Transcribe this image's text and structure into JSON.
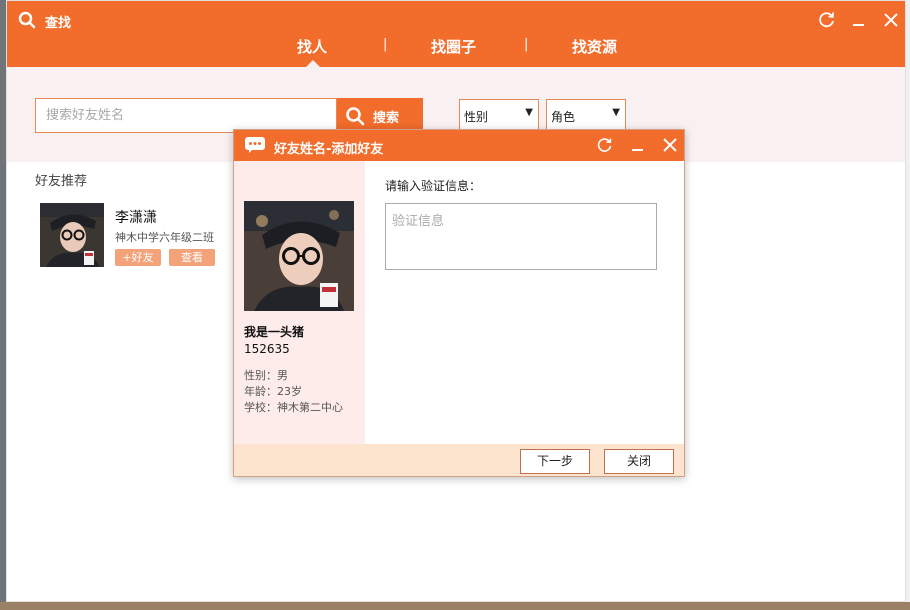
{
  "app": {
    "title": "查找"
  },
  "tabs": [
    {
      "label": "找人",
      "active": true
    },
    {
      "label": "找圈子",
      "active": false
    },
    {
      "label": "找资源",
      "active": false
    }
  ],
  "tab_separator": "|",
  "search": {
    "placeholder": "搜索好友姓名",
    "button_label": "搜索",
    "gender_select": "性别",
    "role_select": "角色"
  },
  "recommend": {
    "title": "好友推荐",
    "friend": {
      "name": "李潇潇",
      "school": "神木中学六年级二班",
      "add_label": "+好友",
      "view_label": "查看"
    }
  },
  "dialog": {
    "title": "好友姓名-添加好友",
    "profile": {
      "name": "我是一头猪",
      "id": "152635",
      "gender": "性别：男",
      "age": "年龄：23岁",
      "school": "学校：神木第二中心"
    },
    "verify_label": "请输入验证信息：",
    "verify_placeholder": "验证信息",
    "next_label": "下一步",
    "close_label": "关闭"
  },
  "colors": {
    "accent": "#f26c2b",
    "light_bg": "#f9f1f1",
    "pink_panel": "#fdecea",
    "footer_bg": "#fde4cf",
    "button_soft": "#f3a27a"
  },
  "icons": [
    "search-icon",
    "refresh-icon",
    "minimize-icon",
    "close-icon",
    "chat-bubble-icon",
    "dropdown-arrow-icon"
  ]
}
